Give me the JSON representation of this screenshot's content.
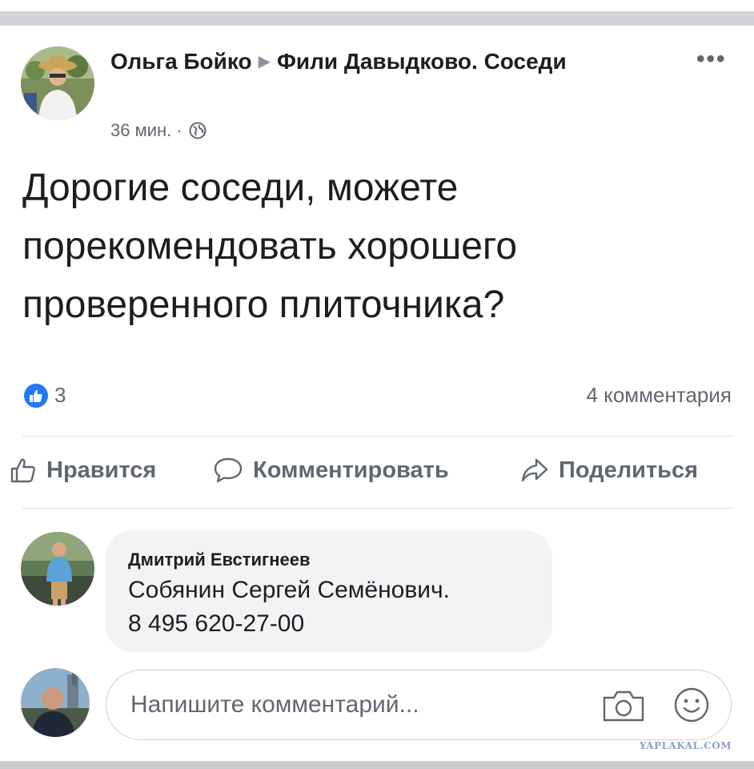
{
  "post": {
    "author": "Ольга Бойко",
    "group": "Фили Давыдково. Соседи",
    "time": "36 мин.",
    "more_label": "•••",
    "text": "Дорогие соседи, можете порекомендовать хорошего проверенного плиточника?",
    "reactions_count": "3",
    "comments_count": "4 комментария"
  },
  "actions": {
    "like": "Нравится",
    "comment": "Комментировать",
    "share": "Поделиться"
  },
  "comment": {
    "author": "Дмитрий Евстигнеев",
    "line1": "Собянин Сергей Семёнович.",
    "line2": "8 495 620-27-00"
  },
  "composer": {
    "placeholder": "Напишите комментарий..."
  },
  "watermark": "YAPLAKAL.COM",
  "colors": {
    "accent": "#2078f4",
    "text": "#1c1e21",
    "secondary": "#606770",
    "bubble": "#f2f3f5"
  }
}
